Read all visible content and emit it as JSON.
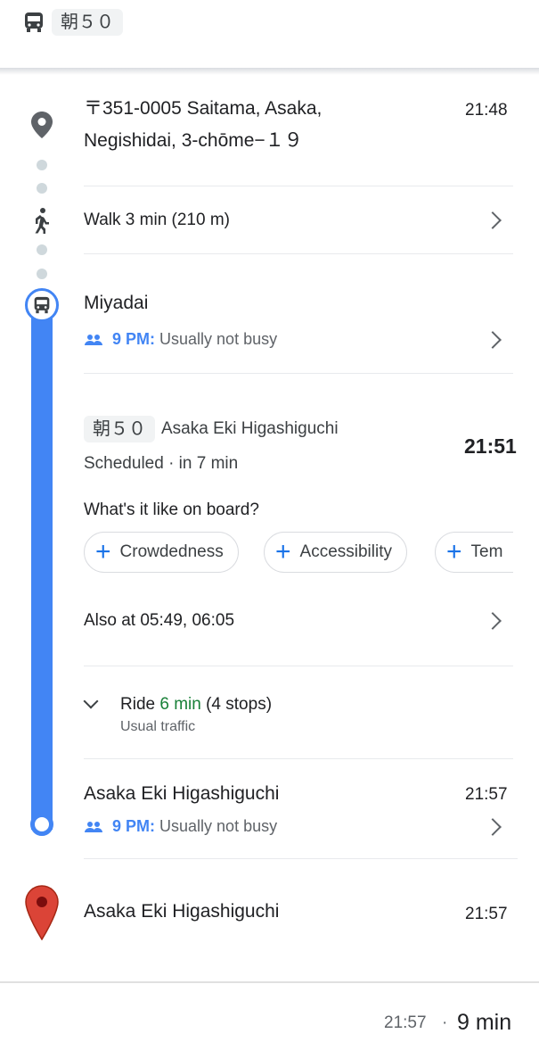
{
  "header": {
    "route_chip": "朝５０"
  },
  "origin": {
    "address_line1": "〒351-0005 Saitama, Asaka,",
    "address_line2": "Negishidai, 3-chōme−１９",
    "time": "21:48"
  },
  "walk": {
    "label": "Walk 3 min (210 m)"
  },
  "first_stop": {
    "name": "Miyadai",
    "busy_time": "9 PM:",
    "busy_text": "Usually not busy"
  },
  "bus": {
    "route_chip": "朝５０",
    "headsign": "Asaka Eki Higashiguchi",
    "scheduled": "Scheduled · in 7 min",
    "depart_time": "21:51",
    "onboard_question": "What's it like on board?",
    "pills": [
      "Crowdedness",
      "Accessibility",
      "Tem"
    ],
    "also_at": "Also at 05:49, 06:05"
  },
  "ride": {
    "prefix": "Ride ",
    "duration": "6 min",
    "stops": " (4 stops)",
    "traffic": "Usual traffic"
  },
  "last_stop": {
    "name": "Asaka Eki Higashiguchi",
    "time": "21:57",
    "busy_time": "9 PM:",
    "busy_text": "Usually not busy"
  },
  "destination": {
    "name": "Asaka Eki Higashiguchi",
    "time": "21:57"
  },
  "footer": {
    "arrival": "21:57",
    "separator": "·",
    "total": "9 min"
  },
  "colors": {
    "accent": "#4285f4",
    "ride_green": "#188038",
    "pin_red": "#db4437"
  }
}
